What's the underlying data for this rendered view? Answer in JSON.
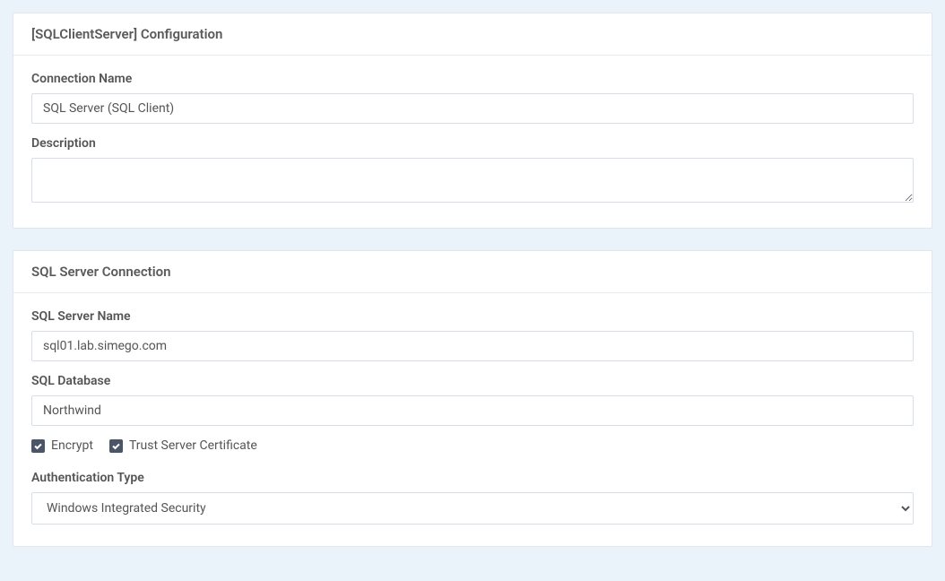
{
  "panel1": {
    "title": "[SQLClientServer] Configuration",
    "connection_name_label": "Connection Name",
    "connection_name_value": "SQL Server (SQL Client)",
    "description_label": "Description",
    "description_value": ""
  },
  "panel2": {
    "title": "SQL Server Connection",
    "server_name_label": "SQL Server Name",
    "server_name_value": "sql01.lab.simego.com",
    "database_label": "SQL Database",
    "database_value": "Northwind",
    "encrypt_label": "Encrypt",
    "encrypt_checked": true,
    "trust_cert_label": "Trust Server Certificate",
    "trust_cert_checked": true,
    "auth_type_label": "Authentication Type",
    "auth_type_value": "Windows Integrated Security"
  }
}
